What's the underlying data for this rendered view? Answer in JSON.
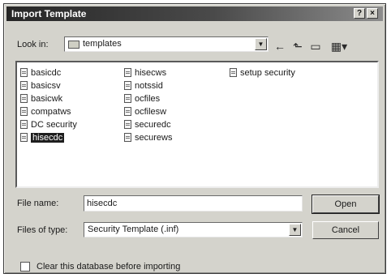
{
  "dialog": {
    "title": "Import Template",
    "title_buttons": {
      "help": "?",
      "close": "×"
    }
  },
  "look_in": {
    "label": "Look in:",
    "value": "templates"
  },
  "toolbar": {
    "back_glyph": "←",
    "up_glyph": "⬑",
    "new_folder_glyph": "▭",
    "views_glyph": "▦▾"
  },
  "files": {
    "column1": [
      {
        "name": "basicdc",
        "selected": false
      },
      {
        "name": "basicsv",
        "selected": false
      },
      {
        "name": "basicwk",
        "selected": false
      },
      {
        "name": "compatws",
        "selected": false
      },
      {
        "name": "DC security",
        "selected": false
      },
      {
        "name": "hisecdc",
        "selected": true
      }
    ],
    "column2": [
      {
        "name": "hisecws",
        "selected": false
      },
      {
        "name": "notssid",
        "selected": false
      },
      {
        "name": "ocfiles",
        "selected": false
      },
      {
        "name": "ocfilesw",
        "selected": false
      },
      {
        "name": "securedc",
        "selected": false
      },
      {
        "name": "securews",
        "selected": false
      }
    ],
    "column3": [
      {
        "name": "setup security",
        "selected": false
      }
    ]
  },
  "file_name": {
    "label": "File name:",
    "value": "hisecdc"
  },
  "files_of_type": {
    "label": "Files of type:",
    "value": "Security Template (.inf)"
  },
  "buttons": {
    "open": "Open",
    "cancel": "Cancel"
  },
  "checkbox": {
    "label": "Clear this database before importing",
    "checked": false
  }
}
